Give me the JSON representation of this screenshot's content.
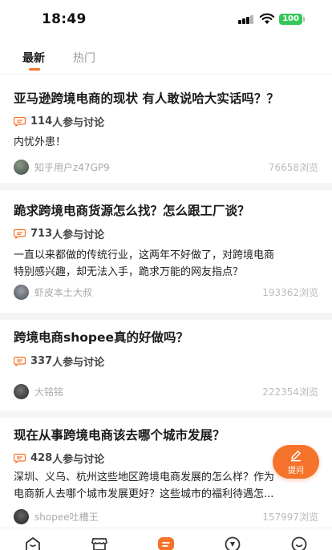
{
  "status_bar": {
    "time": "18:49",
    "battery": "100",
    "battery_color": "#34c759"
  },
  "tabs": [
    {
      "label": "最新",
      "active": true
    },
    {
      "label": "热门",
      "active": false
    }
  ],
  "accent_color": "#f5732a",
  "questions": [
    {
      "title": "亚马逊跨境电商的现状 有人敢说哈大实话吗？？",
      "participants": "114",
      "participants_suffix": "人参与讨论",
      "excerpt": "内忧外患！",
      "author": "知乎用户z47GP9",
      "views": "76658浏览"
    },
    {
      "title": "跪求跨境电商货源怎么找？怎么跟工厂谈？",
      "participants": "713",
      "participants_suffix": "人参与讨论",
      "excerpt_lines": [
        "一直以来都做的传统行业，这两年不好做了，对跨境电商",
        "特别感兴趣，却无法入手，跪求万能的网友指点？"
      ],
      "author": "虾皮本土大叔",
      "views": "193362浏览"
    },
    {
      "title": "跨境电商shopee真的好做吗？",
      "participants": "337",
      "participants_suffix": "人参与讨论",
      "author": "大铭铭",
      "views": "222354浏览"
    },
    {
      "title": "现在从事跨境电商该去哪个城市发展？",
      "participants": "428",
      "participants_suffix": "人参与讨论",
      "excerpt_lines": [
        "深圳、义乌、杭州这些地区跨境电商发展的怎么样？作为",
        "电商新人去哪个城市发展更好？这些城市的福利待遇怎..."
      ],
      "author": "shopee吐槽王",
      "views": "157997浏览"
    }
  ],
  "fab": {
    "label": "提问",
    "icon": "pencil-icon"
  },
  "bottom_nav": [
    {
      "icon": "home-icon"
    },
    {
      "icon": "shop-icon"
    },
    {
      "icon": "discuss-icon",
      "active": true
    },
    {
      "icon": "compass-icon"
    },
    {
      "icon": "profile-icon"
    }
  ]
}
